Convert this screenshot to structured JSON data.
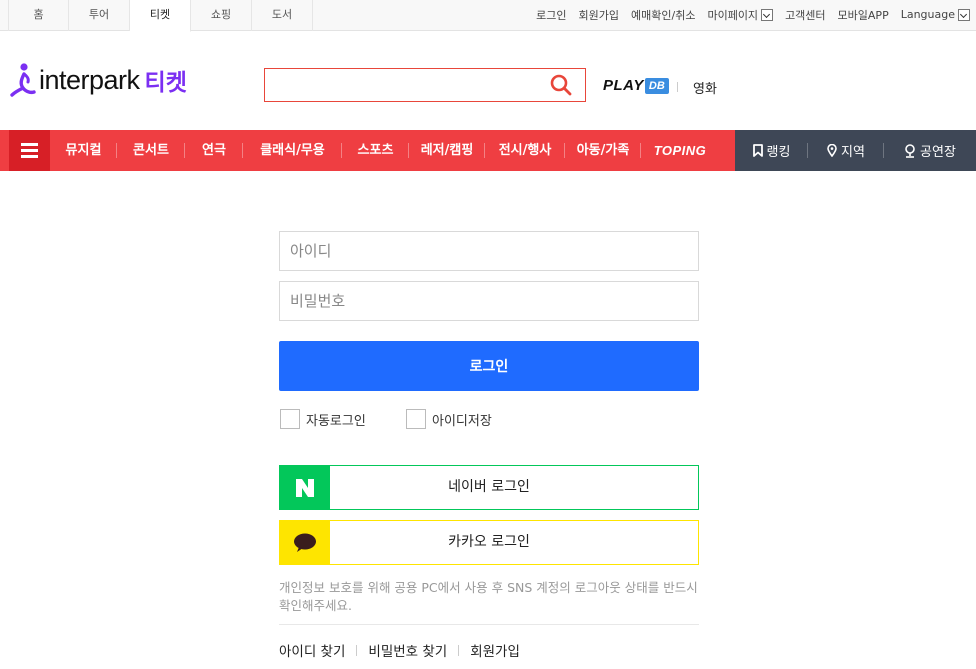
{
  "top_tabs": [
    "홈",
    "투어",
    "티켓",
    "쇼핑",
    "도서"
  ],
  "top_tab_active": "티켓",
  "top_links": {
    "login": "로그인",
    "signup": "회원가입",
    "reservation": "예매확인/취소",
    "mypage": "마이페이지",
    "support": "고객센터",
    "mobile": "모바일APP",
    "language": "Language"
  },
  "header": {
    "logo_text": "interpark",
    "logo_ticket": "티켓",
    "search_placeholder": "",
    "playdb_play": "PLAY",
    "playdb_db": "DB",
    "movie": "영화"
  },
  "nav": {
    "items": [
      "뮤지컬",
      "콘서트",
      "연극",
      "클래식/무용",
      "스포츠",
      "레저/캠핑",
      "전시/행사",
      "아동/가족",
      "TOPING"
    ],
    "right_items": [
      {
        "label": "랭킹",
        "icon": "bookmark-icon"
      },
      {
        "label": "지역",
        "icon": "location-pin-icon"
      },
      {
        "label": "공연장",
        "icon": "venue-pin-icon"
      }
    ]
  },
  "login": {
    "id_placeholder": "아이디",
    "pw_placeholder": "비밀번호",
    "submit": "로그인",
    "auto_login": "자동로그인",
    "save_id": "아이디저장",
    "naver": "네이버 로그인",
    "kakao": "카카오 로그인",
    "notice": "개인정보 보호를 위해 공용 PC에서 사용 후 SNS 계정의 로그아웃 상태를 반드시 확인해주세요.",
    "find_id": "아이디 찾기",
    "find_pw": "비밀번호 찾기",
    "join": "회원가입"
  },
  "colors": {
    "nav_red": "#ef3e42",
    "nav_dark": "#3e4756",
    "login_blue": "#1f6bff",
    "naver_green": "#03c75a",
    "kakao_yellow": "#fee500",
    "brand_purple": "#7b2ff2"
  }
}
